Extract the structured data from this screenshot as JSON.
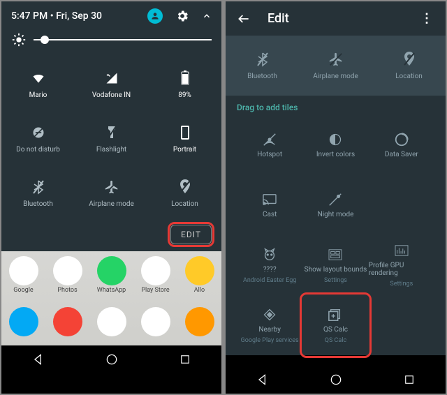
{
  "left": {
    "status": {
      "time": "5:47 PM",
      "sep": " • ",
      "date": "Fri, Sep 30"
    },
    "brightness_pct": 15,
    "tiles_row1": [
      {
        "label": "Mario",
        "icon": "wifi",
        "active": true
      },
      {
        "label": "Vodafone IN",
        "icon": "signal-off",
        "active": true
      },
      {
        "label": "89%",
        "icon": "battery",
        "active": true
      }
    ],
    "tiles_row2": [
      {
        "label": "Do not disturb",
        "icon": "dnd",
        "active": false
      },
      {
        "label": "Flashlight",
        "icon": "flashlight",
        "active": false
      },
      {
        "label": "Portrait",
        "icon": "portrait",
        "active": true
      }
    ],
    "tiles_row3": [
      {
        "label": "Bluetooth",
        "icon": "bluetooth",
        "active": false
      },
      {
        "label": "Airplane mode",
        "icon": "airplane",
        "active": false
      },
      {
        "label": "Location",
        "icon": "location",
        "active": false
      }
    ],
    "edit_label": "EDIT",
    "apps_row1": [
      {
        "label": "Google",
        "color": "#fff"
      },
      {
        "label": "Photos",
        "color": "#fff"
      },
      {
        "label": "WhatsApp",
        "color": "#25d366"
      },
      {
        "label": "Play Store",
        "color": "#fff"
      },
      {
        "label": "Allo",
        "color": "#ffca28"
      }
    ],
    "apps_row2": [
      {
        "label": "",
        "color": "#03a9f4"
      },
      {
        "label": "",
        "color": "#f44336"
      },
      {
        "label": "",
        "color": "#fff"
      },
      {
        "label": "",
        "color": "#fff"
      },
      {
        "label": "",
        "color": "#ff9800"
      }
    ]
  },
  "right": {
    "header": {
      "title": "Edit"
    },
    "enabled_tiles": [
      {
        "label": "Bluetooth",
        "icon": "bluetooth"
      },
      {
        "label": "Airplane mode",
        "icon": "airplane"
      },
      {
        "label": "Location",
        "icon": "location"
      }
    ],
    "drag_label": "Drag to add tiles",
    "drag_tiles_row1": [
      {
        "label": "Hotspot",
        "icon": "hotspot"
      },
      {
        "label": "Invert colors",
        "icon": "invert"
      },
      {
        "label": "Data Saver",
        "icon": "datasaver"
      }
    ],
    "drag_tiles_row2": [
      {
        "label": "Cast",
        "icon": "cast"
      },
      {
        "label": "Night mode",
        "icon": "night"
      }
    ],
    "drag_tiles_row3": [
      {
        "label": "????",
        "sub": "Android Easter Egg",
        "icon": "cat"
      },
      {
        "label": "Show layout bounds",
        "sub": "Settings",
        "icon": "bounds"
      },
      {
        "label": "Profile GPU rendering",
        "sub": "Settings",
        "icon": "gpu"
      }
    ],
    "drag_tiles_row4": [
      {
        "label": "Nearby",
        "sub": "Google Play services",
        "icon": "nearby"
      },
      {
        "label": "QS Calc",
        "sub": "QS Calc",
        "icon": "qscalc",
        "highlight": true
      }
    ]
  }
}
